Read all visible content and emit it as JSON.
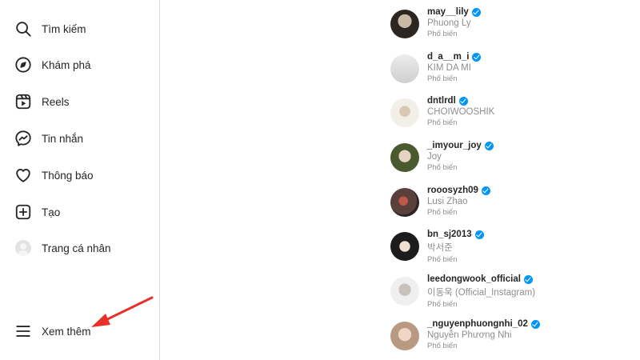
{
  "sidebar": {
    "items": [
      {
        "label": "Tìm kiếm",
        "icon": "search-icon"
      },
      {
        "label": "Khám phá",
        "icon": "compass-icon"
      },
      {
        "label": "Reels",
        "icon": "reels-icon"
      },
      {
        "label": "Tin nhắn",
        "icon": "messenger-icon"
      },
      {
        "label": "Thông báo",
        "icon": "heart-icon"
      },
      {
        "label": "Tạo",
        "icon": "plus-square-icon"
      },
      {
        "label": "Trang cá nhân",
        "icon": "profile-avatar"
      }
    ],
    "more": {
      "label": "Xem thêm",
      "icon": "menu-icon"
    }
  },
  "annotation": {
    "arrow_color": "#e8312a"
  },
  "colors": {
    "verified": "#0095f6",
    "secondary_text": "#8e8e8e",
    "divider": "#dbdbdb"
  },
  "accounts": [
    {
      "username": "may__lily",
      "full_name": "Phuong Ly",
      "subtitle": "Phổ biến"
    },
    {
      "username": "d_a__m_i",
      "full_name": "KIM DA MI",
      "subtitle": "Phổ biến"
    },
    {
      "username": "dntlrdl",
      "full_name": "CHOIWOOSHIK",
      "subtitle": "Phổ biến"
    },
    {
      "username": "_imyour_joy",
      "full_name": "Joy",
      "subtitle": "Phổ biến"
    },
    {
      "username": "rooosyzh09",
      "full_name": "Lusi Zhao",
      "subtitle": "Phổ biến"
    },
    {
      "username": "bn_sj2013",
      "full_name": "박서준",
      "subtitle": "Phổ biến"
    },
    {
      "username": "leedongwook_official",
      "full_name": "이동욱 (Official_Instagram)",
      "subtitle": "Phổ biến"
    },
    {
      "username": "_nguyenphuongnhi_02",
      "full_name": "Nguyễn Phương Nhi",
      "subtitle": "Phổ biến"
    }
  ]
}
